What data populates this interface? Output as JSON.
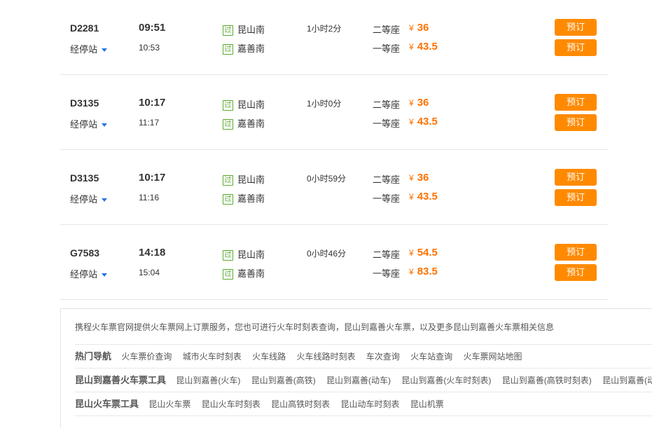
{
  "trains": [
    {
      "train_no": "D2281",
      "stops_label": "经停站",
      "dep_time": "09:51",
      "arr_time": "10:53",
      "pass_badge": "过",
      "from_station": "昆山南",
      "to_station": "嘉善南",
      "duration": "1小时2分",
      "seat1": "二等座",
      "price1": "36",
      "seat2": "一等座",
      "price2": "43.5",
      "currency": "¥",
      "book_label": "预订"
    },
    {
      "train_no": "D3135",
      "stops_label": "经停站",
      "dep_time": "10:17",
      "arr_time": "11:17",
      "pass_badge": "过",
      "from_station": "昆山南",
      "to_station": "嘉善南",
      "duration": "1小时0分",
      "seat1": "二等座",
      "price1": "36",
      "seat2": "一等座",
      "price2": "43.5",
      "currency": "¥",
      "book_label": "预订"
    },
    {
      "train_no": "D3135",
      "stops_label": "经停站",
      "dep_time": "10:17",
      "arr_time": "11:16",
      "pass_badge": "过",
      "from_station": "昆山南",
      "to_station": "嘉善南",
      "duration": "0小时59分",
      "seat1": "二等座",
      "price1": "36",
      "seat2": "一等座",
      "price2": "43.5",
      "currency": "¥",
      "book_label": "预订"
    },
    {
      "train_no": "G7583",
      "stops_label": "经停站",
      "dep_time": "14:18",
      "arr_time": "15:04",
      "pass_badge": "过",
      "from_station": "昆山南",
      "to_station": "嘉善南",
      "duration": "0小时46分",
      "seat1": "二等座",
      "price1": "54.5",
      "seat2": "一等座",
      "price2": "83.5",
      "currency": "¥",
      "book_label": "预订"
    }
  ],
  "info": {
    "intro": "携程火车票官网提供火车票网上订票服务，您也可进行火车时刻表查询，昆山到嘉善火车票，以及更多昆山到嘉善火车票相关信息",
    "hot_nav": {
      "title": "热门导航",
      "links": [
        "火车票价查询",
        "城市火车时刻表",
        "火车线路",
        "火车线路时刻表",
        "车次查询",
        "火车站查询",
        "火车票网站地图"
      ]
    },
    "route_tools": {
      "title": "昆山到嘉善火车票工具",
      "links": [
        "昆山到嘉善(火车)",
        "昆山到嘉善(高铁)",
        "昆山到嘉善(动车)",
        "昆山到嘉善(火车时刻表)",
        "昆山到嘉善(高铁时刻表)",
        "昆山到嘉善(动车时"
      ]
    },
    "kunshan_tools": {
      "title": "昆山火车票工具",
      "links": [
        "昆山火车票",
        "昆山火车时刻表",
        "昆山高铁时刻表",
        "昆山动车时刻表",
        "昆山机票"
      ]
    }
  }
}
